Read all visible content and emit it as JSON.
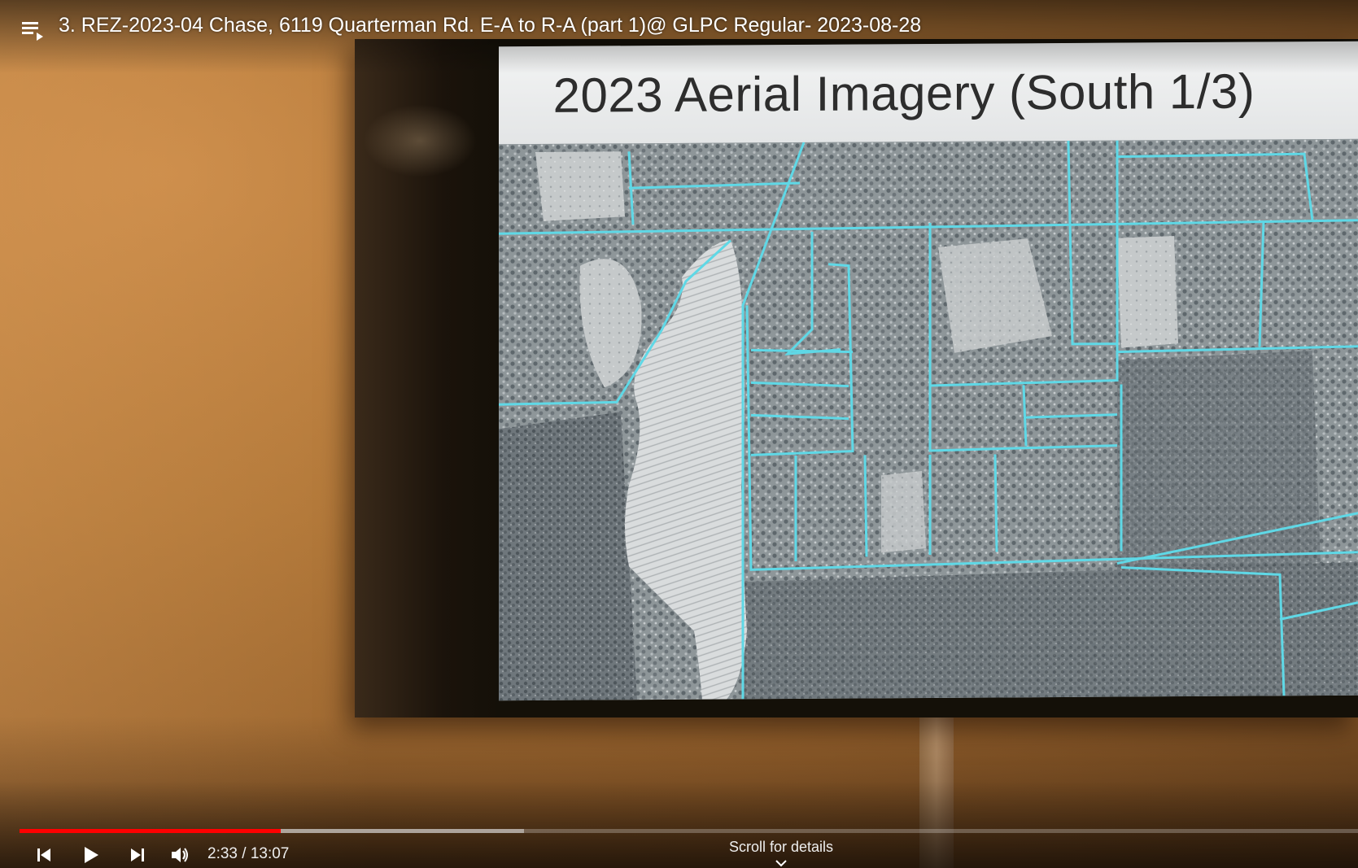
{
  "player": {
    "title": "3. REZ-2023-04 Chase, 6119 Quarterman Rd. E-A to R-A (part 1)@ GLPC Regular- 2023-08-28",
    "current_time": "2:33",
    "separator": " / ",
    "duration": "13:07",
    "time_text": "2:33 / 13:07",
    "played_fraction": 0.195,
    "buffered_fraction": 0.377,
    "scroll_hint": "Scroll for details",
    "accent_color": "#ff0000"
  },
  "slide": {
    "title": "2023 Aerial Imagery (South 1/3)"
  },
  "icons": {
    "playlist": "playlist-icon",
    "previous": "skip-previous-icon",
    "play": "play-icon",
    "next": "skip-next-icon",
    "volume": "volume-icon",
    "scroll": "chevron-down-icon"
  },
  "colors": {
    "parcel_lines": "#5fd8e6",
    "title_bar": "#eceeef"
  }
}
